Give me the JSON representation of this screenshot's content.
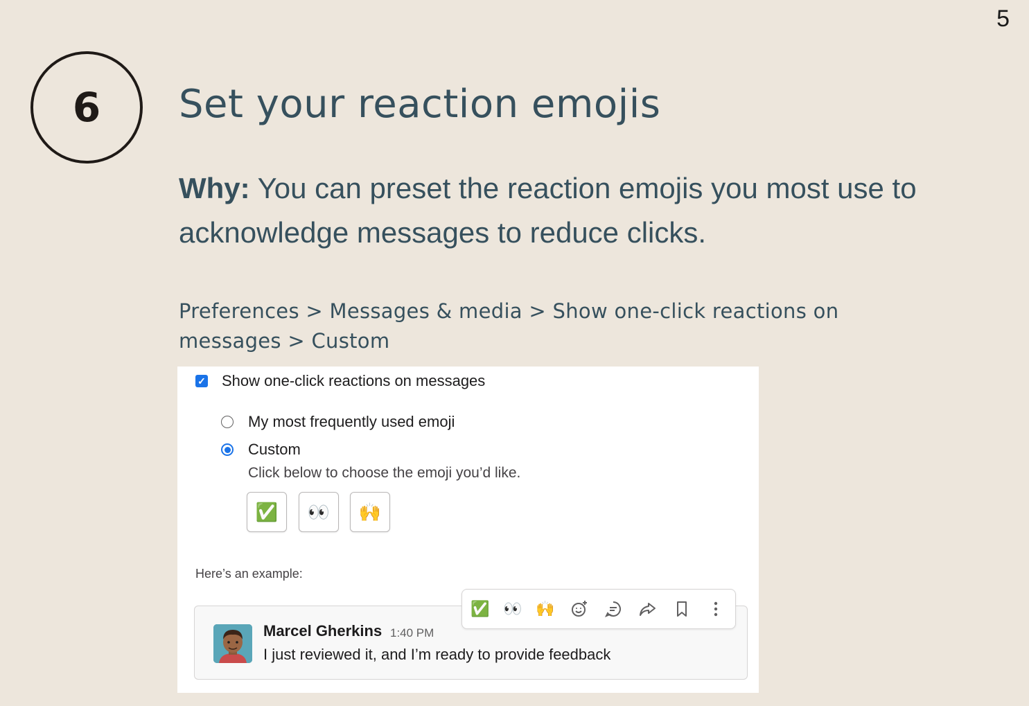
{
  "page_number": "5",
  "step": {
    "number": "6",
    "title": "Set your reaction emojis"
  },
  "why": {
    "label": "Why:",
    "text": "You can preset the reaction emojis you most use to acknowledge messages to reduce clicks."
  },
  "path": "Preferences > Messages & media > Show one-click reactions on messages > Custom",
  "settings": {
    "checkbox_label": "Show one-click reactions on messages",
    "checkbox_checked": true,
    "options": [
      {
        "label": "My most frequently used emoji",
        "selected": false
      },
      {
        "label": "Custom",
        "selected": true
      }
    ],
    "hint": "Click below to choose the emoji you’d like.",
    "emojis": [
      "✅",
      "👀",
      "🙌"
    ]
  },
  "example": {
    "label": "Here’s an example:",
    "author": "Marcel Gherkins",
    "time": "1:40 PM",
    "text": "I just reviewed it, and I’m ready to provide feedback",
    "toolbar": [
      "✅",
      "👀",
      "🙌",
      "add-reaction-icon",
      "reply-in-thread-icon",
      "share-icon",
      "bookmark-icon",
      "more-actions-icon"
    ]
  },
  "colors": {
    "background": "#ede6dc",
    "heading": "#36505d",
    "accent": "#1a73e8"
  }
}
